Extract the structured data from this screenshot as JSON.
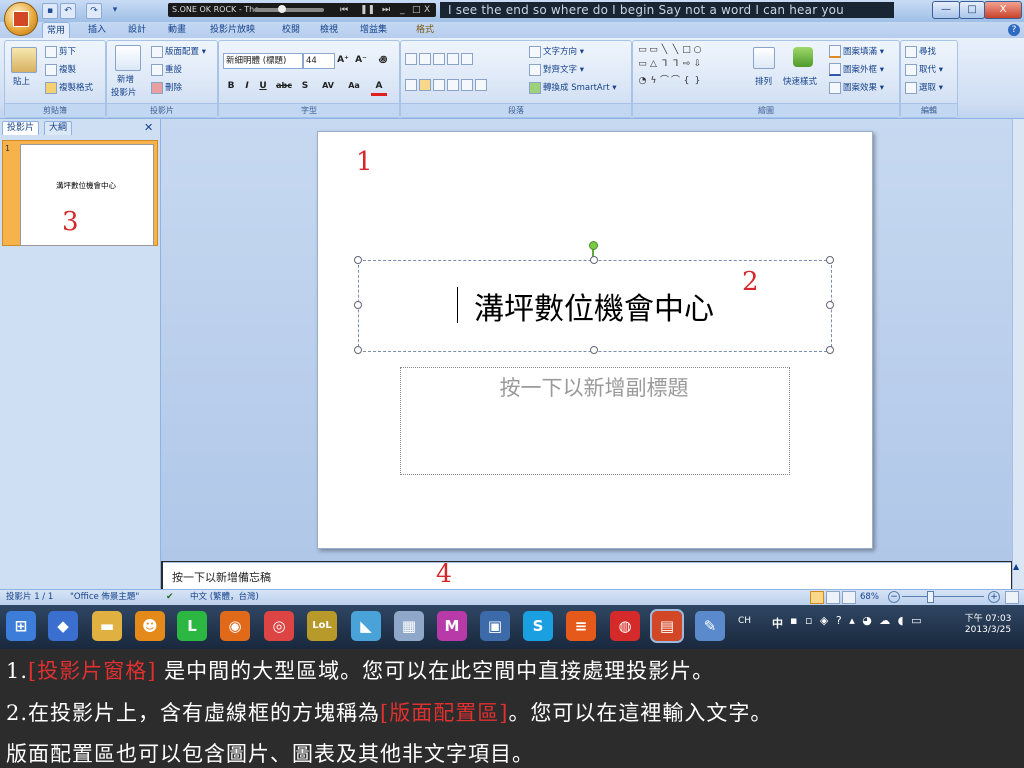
{
  "titlebar": {
    "qat_icons": [
      "save-icon",
      "undo-icon",
      "redo-icon",
      "customize-icon"
    ],
    "media_title": "S.ONE OK ROCK - The",
    "lyrics": "I see the end so where do I begin      Say not a word I can hear you",
    "controls": {
      "min": "—",
      "max": "□",
      "close": "X"
    }
  },
  "tabs": [
    {
      "label": "常用",
      "active": true
    },
    {
      "label": "插入"
    },
    {
      "label": "設計"
    },
    {
      "label": "動畫"
    },
    {
      "label": "投影片放映"
    },
    {
      "label": "校閱"
    },
    {
      "label": "檢視"
    },
    {
      "label": "增益集"
    },
    {
      "label": "格式"
    }
  ],
  "ribbon": {
    "clipboard": {
      "paste": "貼上",
      "cut": "剪下",
      "copy": "複製",
      "format_painter": "複製格式",
      "label": "剪貼簿"
    },
    "slides": {
      "new_slide": "新增",
      "new_slide2": "投影片",
      "layout": "版面配置",
      "reset": "重設",
      "delete": "刪除",
      "label": "投影片"
    },
    "font": {
      "font_name": "新細明體 (標題)",
      "font_size": "44",
      "grow": "A⁺",
      "shrink": "A⁻",
      "clear": "꩜",
      "bold": "B",
      "italic": "I",
      "underline": "U",
      "strike": "abc",
      "shadow": "S",
      "spacing": "AV",
      "case": "Aa",
      "color": "A",
      "label": "字型"
    },
    "paragraph": {
      "text_direction": "文字方向",
      "align_text": "對齊文字",
      "smartart": "轉換成 SmartArt",
      "label": "段落"
    },
    "drawing": {
      "arrange": "排列",
      "quick_styles": "快速樣式",
      "fill": "圖案填滿",
      "outline": "圖案外框",
      "effects": "圖案效果",
      "label": "繪圖"
    },
    "editing": {
      "find": "尋找",
      "replace": "取代",
      "select": "選取",
      "label": "編輯"
    }
  },
  "leftpane": {
    "tab_slides": "投影片",
    "tab_outline": "大綱",
    "close": "✕",
    "thumb_number": "1",
    "thumb_title": "溝坪數位機會中心",
    "label_3": "3"
  },
  "slide": {
    "title": "溝坪數位機會中心",
    "subtitle_placeholder": "按一下以新增副標題",
    "label_1": "1",
    "label_2": "2"
  },
  "notes": {
    "placeholder": "按一下以新增備忘稿",
    "label_4": "4"
  },
  "statusbar": {
    "slide_count": "投影片 1 / 1",
    "theme": "\"Office 佈景主題\"",
    "language": "中文 (繁體，台灣)",
    "zoom": "68%"
  },
  "taskbar": {
    "icons": [
      {
        "name": "start-orb-icon",
        "glyph": "⊞",
        "color": "#3b7dd8"
      },
      {
        "name": "app-icon-1",
        "glyph": "◆",
        "color": "#3a6fd0"
      },
      {
        "name": "file-explorer-icon",
        "glyph": "▬",
        "color": "#e0b040"
      },
      {
        "name": "game-icon",
        "glyph": "☻",
        "color": "#e38a1a"
      },
      {
        "name": "line-icon",
        "glyph": "L",
        "color": "#2cb742"
      },
      {
        "name": "firefox-icon",
        "glyph": "◉",
        "color": "#e06a1a"
      },
      {
        "name": "chrome-icon",
        "glyph": "◎",
        "color": "#d44"
      },
      {
        "name": "app-lol-icon",
        "glyph": "LoL",
        "color": "#b89a2a"
      },
      {
        "name": "folder-icon",
        "glyph": "◣",
        "color": "#4aa3d8"
      },
      {
        "name": "calculator-icon",
        "glyph": "▦",
        "color": "#8fa7c8"
      },
      {
        "name": "app-m-icon",
        "glyph": "M",
        "color": "#b83aa8"
      },
      {
        "name": "app-pc-icon",
        "glyph": "▣",
        "color": "#3d6aa8"
      },
      {
        "name": "skype-icon",
        "glyph": "S",
        "color": "#1aa0e0"
      },
      {
        "name": "app-orange-icon",
        "glyph": "≡",
        "color": "#e55a1a"
      },
      {
        "name": "app-record-icon",
        "glyph": "◍",
        "color": "#d42a2a"
      },
      {
        "name": "powerpoint-icon",
        "glyph": "▤",
        "color": "#d24726"
      },
      {
        "name": "paint-icon",
        "glyph": "✎",
        "color": "#5a8acb"
      }
    ],
    "ime": "CH",
    "ime2": "中",
    "time": "下午 07:03",
    "date": "2013/3/25"
  },
  "caption": {
    "line1_prefix": "1.",
    "line1_highlight": "[投影片窗格]",
    "line1_rest": "是中間的大型區域。您可以在此空間中直接處理投影片。",
    "line2_prefix": "2.在投影片上，含有虛線框的方塊稱為",
    "line2_highlight": "[版面配置區]",
    "line2_rest": "。您可以在這裡輸入文字。",
    "line3": "版面配置區也可以包含圖片、圖表及其他非文字項目。"
  }
}
